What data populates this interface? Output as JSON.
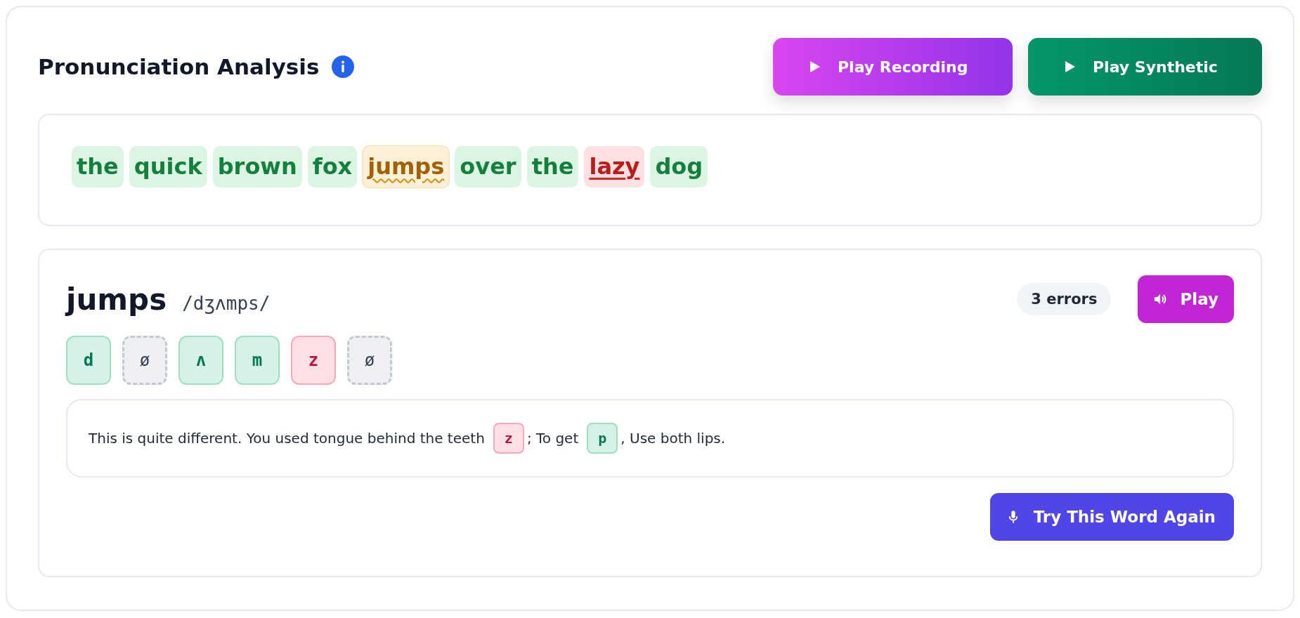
{
  "header": {
    "title": "Pronunciation Analysis",
    "buttons": [
      {
        "label": "Play Recording",
        "kind": "recording"
      },
      {
        "label": "Play Synthetic",
        "kind": "synthetic"
      }
    ]
  },
  "sentence": {
    "words": [
      {
        "text": "the",
        "kind": "correct",
        "selected": false
      },
      {
        "text": "quick",
        "kind": "correct",
        "selected": false
      },
      {
        "text": "brown",
        "kind": "correct",
        "selected": false
      },
      {
        "text": "fox",
        "kind": "correct",
        "selected": false
      },
      {
        "text": "jumps",
        "kind": "warning",
        "selected": true
      },
      {
        "text": "over",
        "kind": "correct",
        "selected": false
      },
      {
        "text": "the",
        "kind": "correct",
        "selected": false
      },
      {
        "text": "lazy",
        "kind": "error",
        "selected": false
      },
      {
        "text": "dog",
        "kind": "correct",
        "selected": false
      }
    ]
  },
  "detail": {
    "word": "jumps",
    "ipa": "/dʒʌmps/",
    "error_count": "3 errors",
    "play_label": "Play",
    "phonemes": [
      {
        "symbol": "d",
        "kind": "correct"
      },
      {
        "symbol": "ø",
        "kind": "missing"
      },
      {
        "symbol": "ʌ",
        "kind": "correct"
      },
      {
        "symbol": "m",
        "kind": "correct"
      },
      {
        "symbol": "z",
        "kind": "error"
      },
      {
        "symbol": "ø",
        "kind": "missing"
      }
    ],
    "feedback": [
      {
        "kind": "text",
        "text": "This is quite different. You used tongue behind the teeth"
      },
      {
        "kind": "error",
        "text": "z"
      },
      {
        "kind": "text",
        "text": "; To get"
      },
      {
        "kind": "correct",
        "text": "p"
      },
      {
        "kind": "text",
        "text": ", Use both lips."
      }
    ],
    "retry_label": "Try This Word Again"
  }
}
